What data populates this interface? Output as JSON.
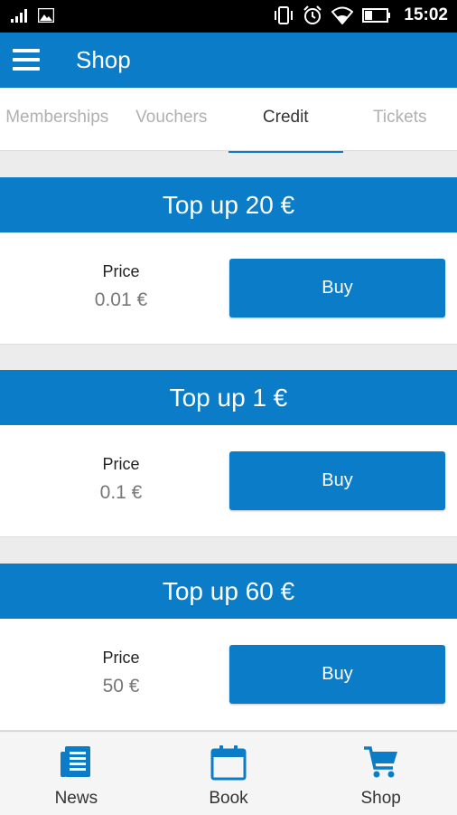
{
  "status_bar": {
    "time": "15:02",
    "left_icons": [
      "signal-icon",
      "image-icon"
    ],
    "right_icons": [
      "vibrate-icon",
      "alarm-icon",
      "wifi-icon",
      "battery-icon"
    ]
  },
  "app_bar": {
    "title": "Shop",
    "menu_icon": "hamburger-menu-icon"
  },
  "tabs": [
    {
      "label": "Memberships",
      "active": false
    },
    {
      "label": "Vouchers",
      "active": false
    },
    {
      "label": "Credit",
      "active": true
    },
    {
      "label": "Tickets",
      "active": false
    }
  ],
  "products": [
    {
      "title": "Top up 20 €",
      "price_label": "Price",
      "price": "0.01 €",
      "button": "Buy"
    },
    {
      "title": "Top up 1 €",
      "price_label": "Price",
      "price": "0.1 €",
      "button": "Buy"
    },
    {
      "title": "Top up 60 €",
      "price_label": "Price",
      "price": "50 €",
      "button": "Buy"
    }
  ],
  "bottom_nav": [
    {
      "label": "News",
      "icon": "news-icon"
    },
    {
      "label": "Book",
      "icon": "calendar-icon"
    },
    {
      "label": "Shop",
      "icon": "cart-icon"
    }
  ],
  "colors": {
    "accent": "#0a7cc8",
    "background": "#ececec",
    "inactive_tab": "#b0b0b0"
  }
}
